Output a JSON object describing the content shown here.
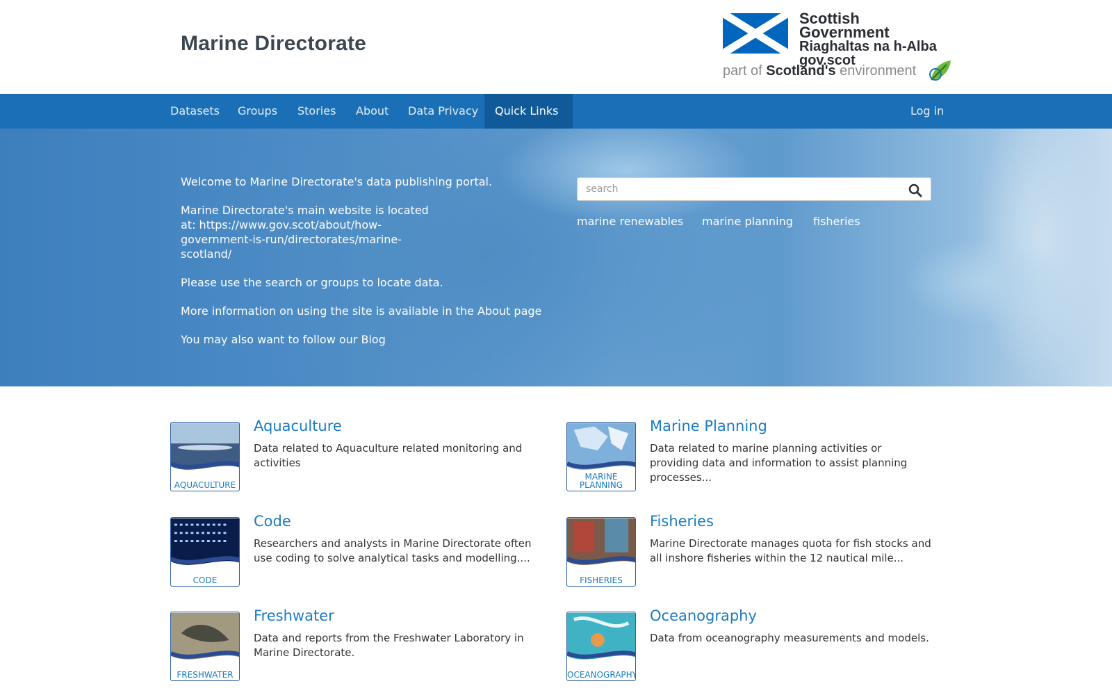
{
  "header": {
    "site_title": "Marine Directorate",
    "gov_logo": {
      "line1": "Scottish Government",
      "line2": "Riaghaltas na h-Alba",
      "line3": "gov.scot",
      "env_prefix": "part of",
      "env_brand": "Scotland's",
      "env_suffix": "environment"
    }
  },
  "nav": {
    "items": [
      {
        "label": "Datasets"
      },
      {
        "label": "Groups"
      },
      {
        "label": "Stories"
      },
      {
        "label": "About"
      },
      {
        "label": "Data Privacy"
      },
      {
        "label": "Quick Links"
      }
    ],
    "login": "Log in"
  },
  "hero": {
    "paragraphs": [
      "Welcome to Marine Directorate's data publishing portal.",
      "Marine Directorate's main website is located at: https://www.gov.scot/about/how-government-is-run/directorates/marine-scotland/",
      "Please use the search or groups to locate data.",
      "More information on using the site is available in the About page",
      "You may also want to follow our Blog"
    ],
    "search_placeholder": "search",
    "tags": [
      "marine renewables",
      "marine planning",
      "fisheries"
    ]
  },
  "groups": [
    {
      "title": "Aquaculture",
      "image_label": "AQUACULTURE",
      "description": "Data related to Aquaculture related monitoring and activities"
    },
    {
      "title": "Marine Planning",
      "image_label": "MARINE PLANNING",
      "description": "Data related to marine planning activities or providing data and information to assist planning processes..."
    },
    {
      "title": "Code",
      "image_label": "CODE",
      "description": "Researchers and analysts in Marine Directorate often use coding to solve analytical tasks and modelling...."
    },
    {
      "title": "Fisheries",
      "image_label": "FISHERIES",
      "description": "Marine Directorate manages quota for fish stocks and all inshore fisheries within the 12 nautical mile..."
    },
    {
      "title": "Freshwater",
      "image_label": "FRESHWATER",
      "description": "Data and reports from the Freshwater Laboratory in Marine Directorate."
    },
    {
      "title": "Oceanography",
      "image_label": "OCEANOGRAPHY",
      "description": "Data from oceanography measurements and models."
    }
  ],
  "colors": {
    "nav_bg": "#1a6fb7",
    "nav_active": "#115a99",
    "link": "#1a7bc1",
    "saltire_blue": "#0065bd"
  }
}
